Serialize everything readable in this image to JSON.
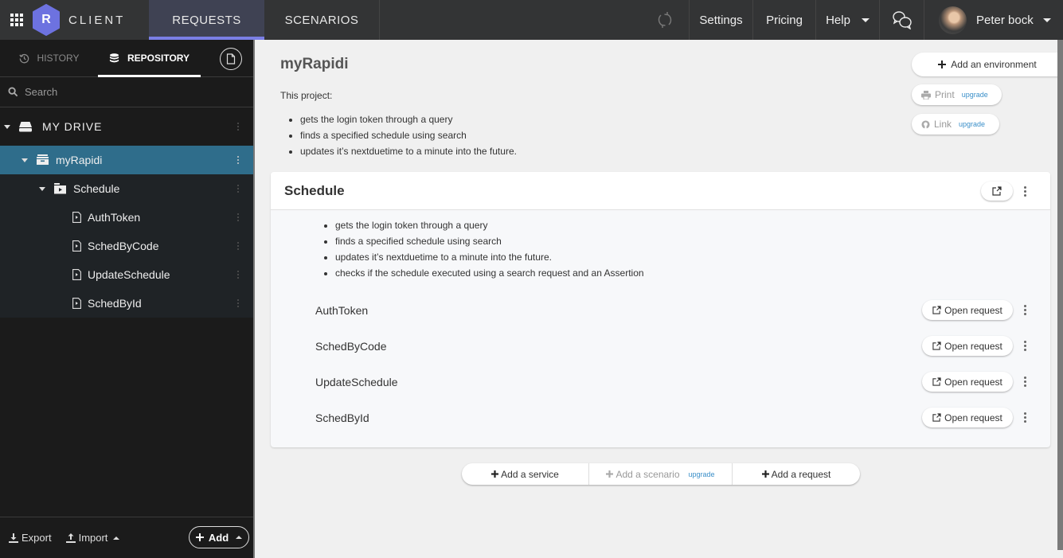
{
  "topbar": {
    "app_name": "CLIENT",
    "logo_letter": "R",
    "tabs": [
      {
        "label": "REQUESTS",
        "active": true
      },
      {
        "label": "SCENARIOS",
        "active": false
      }
    ],
    "settings_label": "Settings",
    "pricing_label": "Pricing",
    "help_label": "Help",
    "user_name": "Peter bock",
    "accent_color": "#7b7fe6"
  },
  "sidebar": {
    "tabs": [
      {
        "label": "HISTORY",
        "active": false
      },
      {
        "label": "REPOSITORY",
        "active": true
      }
    ],
    "search": {
      "placeholder": "Search",
      "value": ""
    },
    "drive_label": "MY DRIVE",
    "tree": [
      {
        "label": "myRapidi",
        "type": "project",
        "selected": true
      },
      {
        "label": "Schedule",
        "type": "folder",
        "selected": false
      },
      {
        "label": "AuthToken",
        "type": "request",
        "selected": false
      },
      {
        "label": "SchedByCode",
        "type": "request",
        "selected": false
      },
      {
        "label": "UpdateSchedule",
        "type": "request",
        "selected": false
      },
      {
        "label": "SchedById",
        "type": "request",
        "selected": false
      }
    ],
    "footer": {
      "export_label": "Export",
      "import_label": "Import",
      "add_label": "Add"
    },
    "selected_color": "#2f6d8b"
  },
  "main": {
    "project_title": "myRapidi",
    "intro": "This project:",
    "bullets": [
      "gets the login token through a query",
      "finds a specified schedule using search",
      "updates it’s nextduetime to a minute into the future."
    ],
    "add_environment_label": "Add an environment",
    "print_label": "Print",
    "link_label": "Link",
    "upgrade_label": "upgrade",
    "card": {
      "title": "Schedule",
      "bullets": [
        "gets the login token through a query",
        "finds a specified schedule using search",
        "updates it’s nextduetime to a minute into the future.",
        "checks if the schedule executed using a search request and an Assertion"
      ],
      "requests": [
        {
          "name": "AuthToken",
          "button": "Open request"
        },
        {
          "name": "SchedByCode",
          "button": "Open request"
        },
        {
          "name": "UpdateSchedule",
          "button": "Open request"
        },
        {
          "name": "SchedById",
          "button": "Open request"
        }
      ]
    },
    "add_service_label": "Add a service",
    "add_scenario_label": "Add a scenario",
    "add_request_label": "Add a request",
    "upgrade_color": "#3a8fc9"
  }
}
